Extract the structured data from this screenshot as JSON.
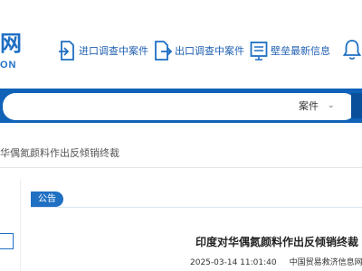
{
  "header": {
    "logo_text": "网",
    "logo_sub": "ON",
    "nav": [
      {
        "label": "进口调查中案件",
        "icon": "import-document-icon"
      },
      {
        "label": "出口调查中案件",
        "icon": "export-document-icon"
      },
      {
        "label": "壁垒最新信息",
        "icon": "news-board-icon"
      }
    ]
  },
  "search": {
    "value": "",
    "select_label": "案件",
    "select_chevron": "⌄"
  },
  "breadcrumb": "华偶氮颜料作出反倾销终裁",
  "notice": {
    "tag": "公告",
    "title": "印度对华偶氮颜料作出反倾销终裁",
    "datetime": "2025-03-14 11:01:40",
    "source": "中国贸易救济信息网"
  },
  "colors": {
    "brand_blue": "#1f6fc3",
    "search_bar": "#0f62b8"
  }
}
